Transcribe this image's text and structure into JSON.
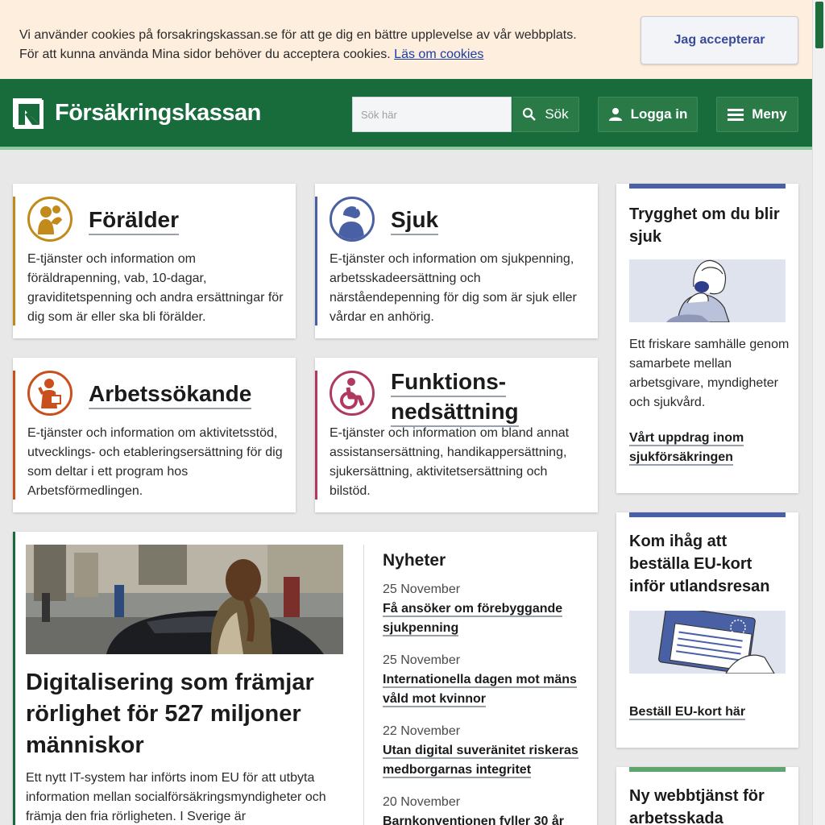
{
  "cookie": {
    "line1": "Vi använder cookies på forsakringskassan.se för att ge dig en bättre upplevelse av vår webbplats.",
    "line2": "För att kunna använda Mina sidor behöver du acceptera cookies.",
    "link": "Läs om cookies",
    "accept": "Jag accepterar"
  },
  "header": {
    "logo_text": "Försäkringskassan",
    "search_placeholder": "Sök här",
    "search_label": "Sök",
    "login_label": "Logga in",
    "menu_label": "Meny"
  },
  "categories": [
    {
      "title": "Förälder",
      "desc": "E-tjänster och information om föräldrapenning, vab, 10-dagar, graviditetspenning och andra ersättningar för dig som är eller ska bli förälder.",
      "color": "#c28a1b"
    },
    {
      "title": "Sjuk",
      "desc": "E-tjänster och information om sjukpenning, arbetsskadeersättning och närståendepenning för dig som är sjuk eller vårdar en anhörig.",
      "color": "#4a60a5"
    },
    {
      "title": "Arbetssökande",
      "desc": "E-tjänster och information om aktivitetsstöd, utvecklings- och etableringsersättning för dig som deltar i ett program hos Arbetsförmedlingen.",
      "color": "#c9501c"
    },
    {
      "title_line1": "Funktions-",
      "title_line2": "nedsättning",
      "desc": "E-tjänster och information om bland annat assistansersättning, handikappersättning, sjukersättning, aktivitetsersättning och bilstöd.",
      "color": "#b03a5f"
    }
  ],
  "side": [
    {
      "title": "Trygghet om du blir sjuk",
      "text": "Ett friskare samhälle genom samarbete mellan arbetsgivare, myndigheter och sjukvård.",
      "link": "Vårt uppdrag inom sjukförsäkringen"
    },
    {
      "title": "Kom ihåg att beställa EU-kort inför utlandsresan",
      "link": "Beställ EU-kort här"
    },
    {
      "title": "Ny webbtjänst för arbetsskada"
    }
  ],
  "feature": {
    "title": "Digitalisering som främjar rörlighet för 527 miljoner människor",
    "text": "Ett nytt IT-system har införts inom EU för att utbyta information mellan socialförsäkringsmyndigheter och främja den fria rörligheten. I Sverige är"
  },
  "news": {
    "heading": "Nyheter",
    "items": [
      {
        "date": "25 November",
        "title": "Få ansöker om förebyggande sjukpenning"
      },
      {
        "date": "25 November",
        "title": "Internationella dagen mot mäns våld mot kvinnor"
      },
      {
        "date": "22 November",
        "title": "Utan digital suveränitet riskeras medborgarnas integritet"
      },
      {
        "date": "20 November",
        "title": "Barnkonventionen fyller 30 år"
      }
    ]
  },
  "colors": {
    "brand": "#186b3b",
    "accent_blue": "#4a60a5"
  }
}
